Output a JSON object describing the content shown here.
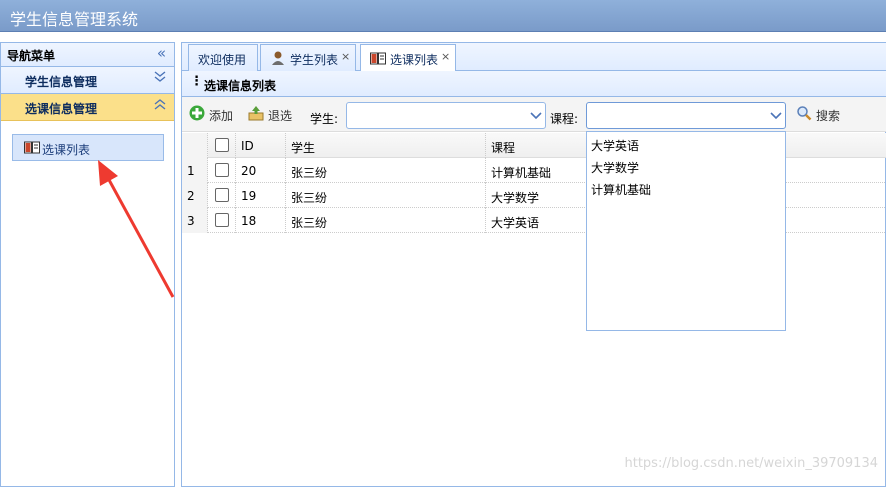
{
  "app": {
    "title": "学生信息管理系统"
  },
  "sidebar": {
    "header": "导航菜单",
    "sections": [
      {
        "label": "学生信息管理"
      },
      {
        "label": "选课信息管理"
      }
    ],
    "menu_items": [
      {
        "label": "选课列表"
      }
    ]
  },
  "tabs": [
    {
      "label": "欢迎使用"
    },
    {
      "label": "学生列表"
    },
    {
      "label": "选课列表"
    }
  ],
  "panel": {
    "title": "选课信息列表"
  },
  "toolbar": {
    "add_label": "添加",
    "drop_label": "退选",
    "student_label": "学生:",
    "course_label": "课程:",
    "search_label": "搜索"
  },
  "grid": {
    "columns": [
      "ID",
      "学生",
      "课程"
    ],
    "rows": [
      {
        "num": "1",
        "id": "20",
        "student": "张三纷",
        "course": "计算机基础"
      },
      {
        "num": "2",
        "id": "19",
        "student": "张三纷",
        "course": "大学数学"
      },
      {
        "num": "3",
        "id": "18",
        "student": "张三纷",
        "course": "大学英语"
      }
    ]
  },
  "course_dropdown": {
    "options": [
      "大学英语",
      "大学数学",
      "计算机基础"
    ]
  },
  "watermark": "https://blog.csdn.net/weixin_39709134",
  "colors": {
    "accent": "#95b8e7",
    "active_section": "#fbe08a",
    "annotation_arrow": "#ee3a30"
  }
}
